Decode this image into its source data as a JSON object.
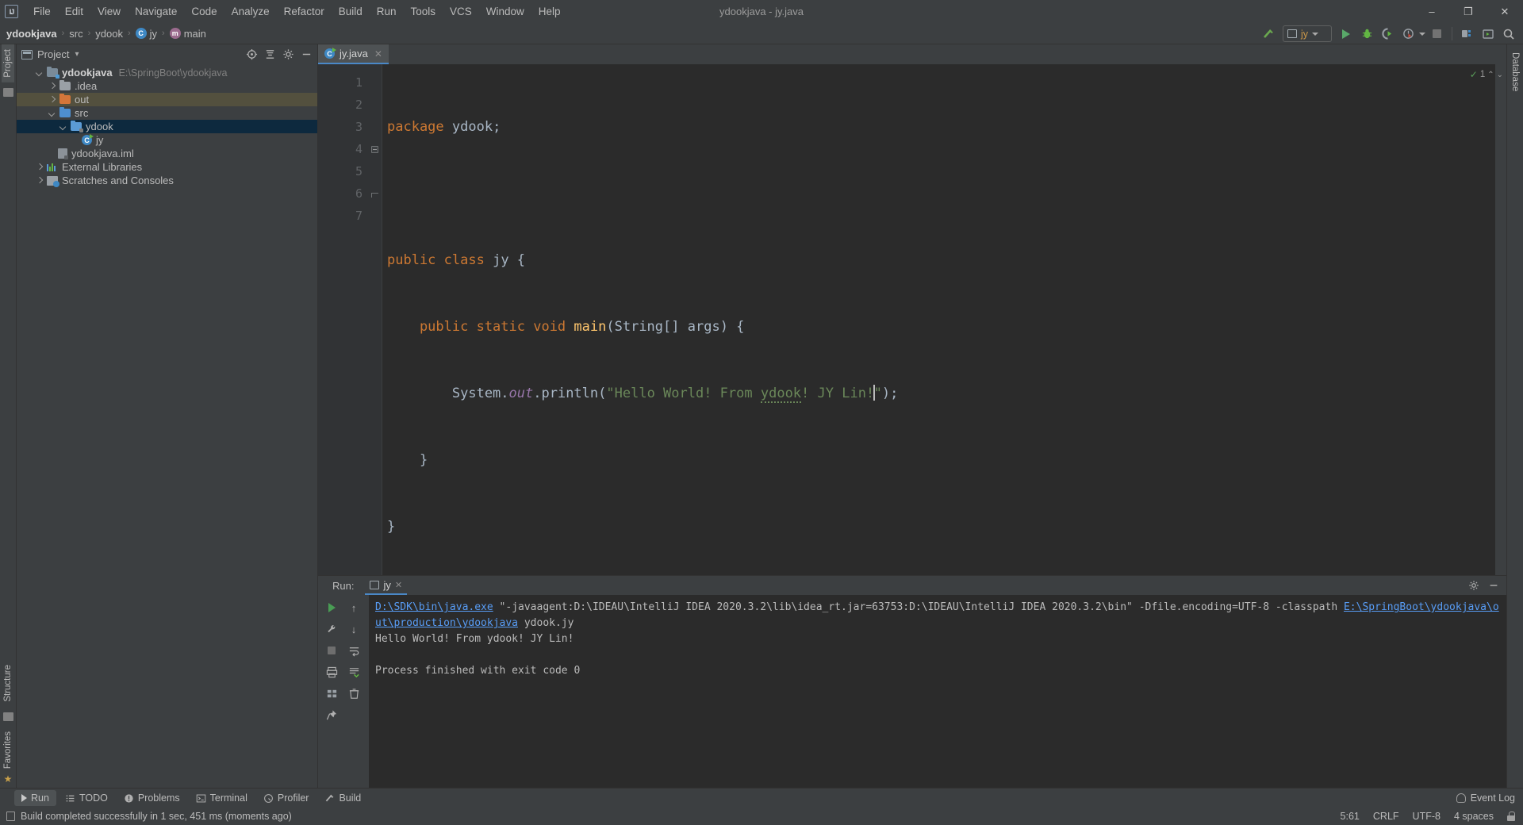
{
  "window": {
    "title": "ydookjava - jy.java",
    "logo": "intellij-idea-logo",
    "minimize": "–",
    "maximize": "❐",
    "close": "✕"
  },
  "menu": {
    "items": [
      "File",
      "Edit",
      "View",
      "Navigate",
      "Code",
      "Analyze",
      "Refactor",
      "Build",
      "Run",
      "Tools",
      "VCS",
      "Window",
      "Help"
    ]
  },
  "breadcrumb": {
    "items": [
      {
        "label": "ydookjava",
        "bold": true,
        "icon": ""
      },
      {
        "label": "src",
        "bold": false,
        "icon": ""
      },
      {
        "label": "ydook",
        "bold": false,
        "icon": ""
      },
      {
        "label": "jy",
        "bold": false,
        "icon": "class-icon"
      },
      {
        "label": "main",
        "bold": false,
        "icon": "method-icon"
      }
    ],
    "separator": "›"
  },
  "toolbar": {
    "build_hammer": "build-icon",
    "run_config_name": "jy",
    "run_label": "Run",
    "debug_label": "Debug",
    "run_with_coverage_label": "Run with Coverage",
    "profile_label": "Profile",
    "stop_label": "Stop",
    "project_structure_label": "Project Structure",
    "layout_label": "Layout",
    "search_label": "Search Everywhere"
  },
  "left_rail": {
    "project_tab": "Project",
    "structure_tab": "Structure",
    "favorites_tab": "Favorites"
  },
  "right_rail": {
    "database_tab": "Database"
  },
  "project_panel": {
    "title": "Project",
    "dropdown_caret": "▾",
    "locate_label": "Select Opened File",
    "collapse_label": "Collapse All",
    "expand_label": "Expand All",
    "settings_label": "Settings",
    "hide_label": "Hide",
    "tree": [
      {
        "label": "ydookjava",
        "path": "E:\\SpringBoot\\ydookjava",
        "indent": 0,
        "arrow": "down",
        "icon": "module-folder-icon",
        "bold": true,
        "state": "none"
      },
      {
        "label": ".idea",
        "path": "",
        "indent": 1,
        "arrow": "right",
        "icon": "folder-grey-icon",
        "bold": false,
        "state": "none"
      },
      {
        "label": "out",
        "path": "",
        "indent": 1,
        "arrow": "right",
        "icon": "folder-orange-icon",
        "bold": false,
        "state": "highlight"
      },
      {
        "label": "src",
        "path": "",
        "indent": 1,
        "arrow": "down",
        "icon": "folder-source-icon",
        "bold": false,
        "state": "none"
      },
      {
        "label": "ydook",
        "path": "",
        "indent": 2,
        "arrow": "down",
        "icon": "folder-package-icon",
        "bold": false,
        "state": "selected"
      },
      {
        "label": "jy",
        "path": "",
        "indent": 3,
        "arrow": "none",
        "icon": "java-class-run-icon",
        "bold": false,
        "state": "none"
      },
      {
        "label": "ydookjava.iml",
        "path": "",
        "indent": 1,
        "arrow": "none",
        "icon": "iml-file-icon",
        "bold": false,
        "state": "none"
      },
      {
        "label": "External Libraries",
        "path": "",
        "indent": 0,
        "arrow": "right",
        "icon": "libraries-icon",
        "bold": false,
        "state": "none"
      },
      {
        "label": "Scratches and Consoles",
        "path": "",
        "indent": 0,
        "arrow": "right",
        "icon": "scratches-icon",
        "bold": false,
        "state": "none"
      }
    ]
  },
  "editor": {
    "tab_label": "jy.java",
    "tab_icon": "java-class-run-icon",
    "tab_close": "✕",
    "inspection_check": "✓",
    "inspection_count": "1",
    "up_arrow": "⌃",
    "down_arrow": "⌄",
    "line_numbers": [
      "1",
      "2",
      "3",
      "4",
      "5",
      "6",
      "7"
    ],
    "code": {
      "l1_kw": "package",
      "l1_pkg": " ydook;",
      "l3_kw1": "public",
      "l3_kw2": " class",
      "l3_name": " jy ",
      "l3_brace": "{",
      "l4_kw": "    public static void",
      "l4_main": " main",
      "l4_paren1": "(",
      "l4_type": "String",
      "l4_args": "[] args",
      "l4_paren2": ") ",
      "l4_brace": "{",
      "l5_sys": "        System.",
      "l5_out": "out",
      "l5_println": ".println",
      "l5_paren": "(",
      "l5_str_a": "\"Hello World! From ",
      "l5_str_typo": "ydook",
      "l5_str_b": "! JY Lin!",
      "l5_str_close": "\"",
      "l5_end": ");",
      "l6": "    }",
      "l7": "}"
    }
  },
  "run_panel": {
    "label": "Run:",
    "tab_name": "jy",
    "tab_close": "✕",
    "settings_label": "Settings",
    "hide_label": "Hide",
    "rerun_label": "Rerun",
    "up_label": "Up",
    "down_label": "Down",
    "settings2_label": "Configure",
    "stop_label": "Stop",
    "wrap_label": "Soft-Wrap",
    "print_label": "Print",
    "scroll_label": "Scroll to End",
    "clear_label": "Clear All",
    "console": {
      "cmd_link": "D:\\SDK\\bin\\java.exe",
      "cmd_args": " \"-javaagent:D:\\IDEAU\\IntelliJ IDEA 2020.3.2\\lib\\idea_rt.jar=63753:D:\\IDEAU\\IntelliJ IDEA 2020.3.2\\bin\" -Dfile.encoding=UTF-8 -classpath ",
      "cmd_classpath_link": "E:\\SpringBoot\\ydookjava\\out\\production\\ydookjava",
      "cmd_main": " ydook.jy",
      "output": "Hello World! From ydook! JY Lin!",
      "blank": "",
      "exit": "Process finished with exit code 0"
    }
  },
  "bottom_strip": {
    "items": [
      {
        "label": "Run",
        "icon": "run-icon",
        "active": true
      },
      {
        "label": "TODO",
        "icon": "todo-icon",
        "active": false
      },
      {
        "label": "Problems",
        "icon": "problems-icon",
        "active": false
      },
      {
        "label": "Terminal",
        "icon": "terminal-icon",
        "active": false
      },
      {
        "label": "Profiler",
        "icon": "profiler-icon",
        "active": false
      },
      {
        "label": "Build",
        "icon": "build-icon",
        "active": false
      }
    ],
    "event_log": "Event Log"
  },
  "statusbar": {
    "message": "Build completed successfully in 1 sec, 451 ms (moments ago)",
    "caret_position": "5:61",
    "line_separator": "CRLF",
    "encoding": "UTF-8",
    "indent": "4 spaces",
    "lock": "read-write-lock-icon"
  },
  "colors": {
    "bg_chrome": "#3c3f41",
    "bg_editor": "#2b2b2b",
    "bg_gutter": "#313335",
    "accent_blue": "#4a88c7",
    "keyword_orange": "#cc7832",
    "string_green": "#6a8759",
    "method_yellow": "#ffc66d",
    "field_purple": "#9876aa",
    "identifier": "#a9b7c6",
    "selection": "#0d293e",
    "highlight": "#53503e",
    "link": "#589df6",
    "run_green": "#499c54"
  }
}
